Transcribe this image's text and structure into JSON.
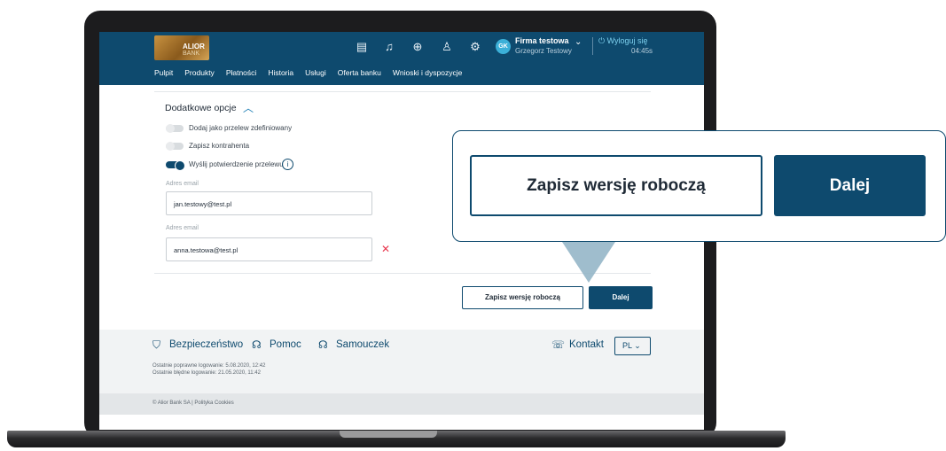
{
  "header": {
    "bank_name": "ALIOR",
    "bank_sub": "BANK",
    "firm": "Firma testowa",
    "user": "Grzegorz Testowy",
    "avatar_initials": "GK",
    "logout": "Wyloguj się",
    "timer": "04:45s",
    "icons": [
      "documents-icon",
      "bell-icon",
      "download-icon",
      "users-icon",
      "settings-icon"
    ],
    "nav": [
      "Pulpit",
      "Produkty",
      "Płatności",
      "Historia",
      "Usługi",
      "Oferta banku",
      "Wnioski i dyspozycje"
    ]
  },
  "form": {
    "section_title": "Dodatkowe opcje",
    "options": [
      {
        "label": "Dodaj jako przelew zdefiniowany",
        "on": false
      },
      {
        "label": "Zapisz kontrahenta",
        "on": false
      },
      {
        "label": "Wyślij potwierdzenie przelewu",
        "on": true
      }
    ],
    "email_label_1": "Adres email",
    "email_value_1": "jan.testowy@test.pl",
    "email_label_2": "Adres email",
    "email_value_2": "anna.testowa@test.pl",
    "save_draft": "Zapisz wersję roboczą",
    "next": "Dalej"
  },
  "footer": {
    "links": [
      "Bezpieczeństwo",
      "Pomoc",
      "Samouczek"
    ],
    "contact": "Kontakt",
    "language": "PL",
    "last_login_ok": "Ostatnie poprawne logowanie: 5.08.2020, 12:42",
    "last_login_fail": "Ostatnie błędne logowanie: 21.05.2020, 11:42",
    "copyright": "© Alior Bank SA | Polityka Cookies"
  },
  "callout": {
    "save_draft": "Zapisz wersję roboczą",
    "next": "Dalej"
  },
  "colors": {
    "brand": "#0e4a6e",
    "accent": "#3cb0d8",
    "danger": "#e8384f"
  }
}
